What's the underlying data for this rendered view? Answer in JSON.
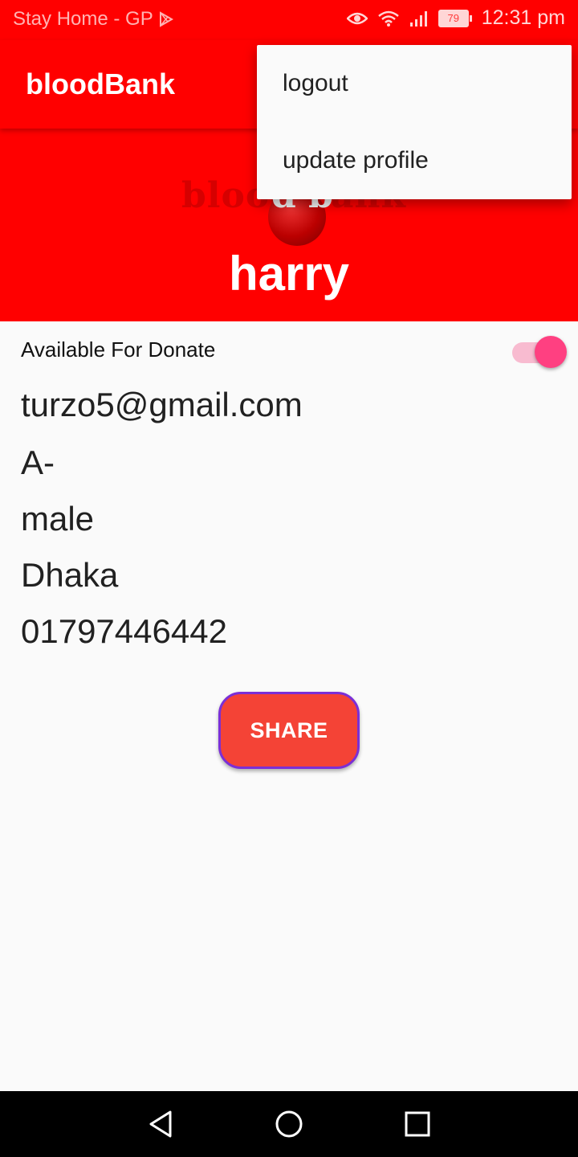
{
  "status_bar": {
    "carrier": "Stay Home - GP",
    "battery": "79",
    "time": "12:31 pm",
    "icons": [
      "play-store-icon",
      "eye-icon",
      "wifi-icon",
      "signal-icon",
      "battery-icon"
    ]
  },
  "app_bar": {
    "title": "bloodBank"
  },
  "header": {
    "logo_text_left": "blood",
    "logo_text_right": "ank",
    "logo_overlay": "d b",
    "name": "harry"
  },
  "menu": {
    "items": [
      {
        "label": "logout"
      },
      {
        "label": "update profile"
      }
    ]
  },
  "profile": {
    "available_label": "Available For Donate",
    "available": true,
    "email": "turzo5@gmail.com",
    "blood_group": "A-",
    "gender": "male",
    "city": "Dhaka",
    "phone": "01797446442"
  },
  "actions": {
    "share_label": "SHARE"
  },
  "colors": {
    "primary": "#ff0000",
    "accent": "#ff4081",
    "button": "#f44336",
    "button_border": "#7b2fd6"
  },
  "nav_bar": {
    "icons": [
      "back-icon",
      "home-icon",
      "recents-icon"
    ]
  }
}
